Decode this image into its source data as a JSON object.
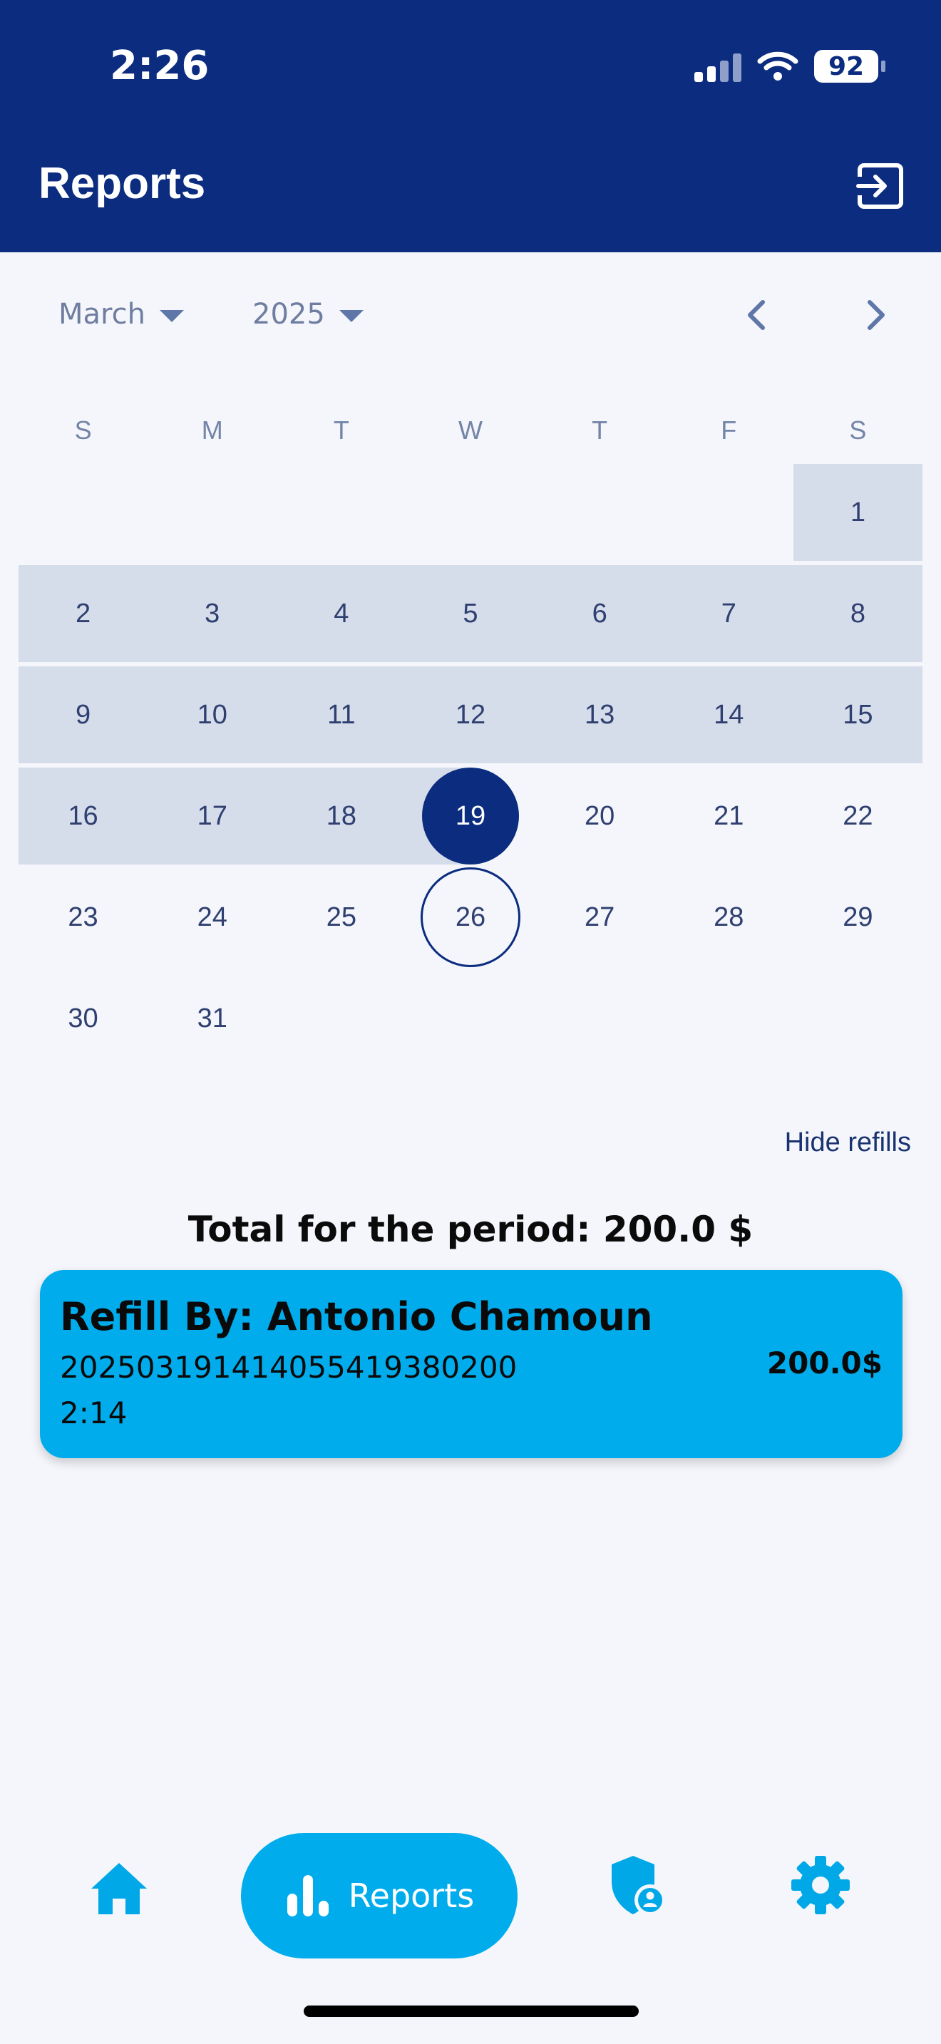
{
  "status_bar": {
    "time": "2:26",
    "battery": "92"
  },
  "header": {
    "title": "Reports"
  },
  "calendar": {
    "month": "March",
    "year": "2025",
    "weekdays": [
      "S",
      "M",
      "T",
      "W",
      "T",
      "F",
      "S"
    ],
    "selected_day": "19",
    "today_day": "26",
    "range_start_day": "1",
    "weeks": [
      [
        "",
        "",
        "",
        "",
        "",
        "",
        "1"
      ],
      [
        "2",
        "3",
        "4",
        "5",
        "6",
        "7",
        "8"
      ],
      [
        "9",
        "10",
        "11",
        "12",
        "13",
        "14",
        "15"
      ],
      [
        "16",
        "17",
        "18",
        "19",
        "20",
        "21",
        "22"
      ],
      [
        "23",
        "24",
        "25",
        "26",
        "27",
        "28",
        "29"
      ],
      [
        "30",
        "31",
        "",
        "",
        "",
        "",
        ""
      ]
    ]
  },
  "filters": {
    "hide_refills_label": "Hide refills"
  },
  "summary": {
    "total_label": "Total for the period: 200.0 $"
  },
  "refills": [
    {
      "title": "Refill By: Antonio Chamoun",
      "id": "20250319141405541938020​0",
      "time": "2:14",
      "amount": "200.0$"
    }
  ],
  "bottom_nav": {
    "items": [
      {
        "icon": "home-icon"
      },
      {
        "icon": "bar-chart-icon",
        "label": "Reports"
      },
      {
        "icon": "shield-user-icon"
      },
      {
        "icon": "gear-icon"
      }
    ]
  },
  "colors": {
    "header_bg": "#0b2c7f",
    "accent": "#00acec",
    "range_bg": "#d5dcea",
    "page_bg": "#f4f6fb"
  }
}
